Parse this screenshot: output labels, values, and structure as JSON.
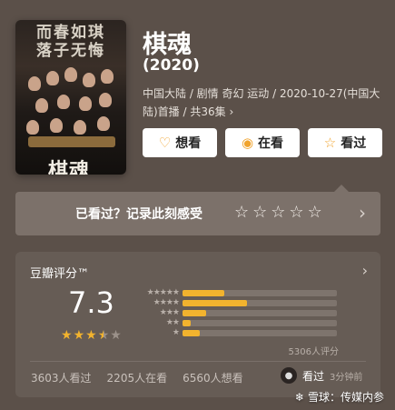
{
  "poster": {
    "tagline_line1": "而春如琪",
    "tagline_line2": "落子无悔",
    "title": "棋魂"
  },
  "movie": {
    "title": "棋魂",
    "year": "(2020)",
    "meta": "中国大陆 / 剧情 奇幻 运动 / 2020-10-27(中国大陆)首播 / 共36集 ›"
  },
  "actions": {
    "want_label": "想看",
    "watching_label": "在看",
    "watched_label": "看过",
    "want_icon": "add-heart-icon",
    "watching_icon": "target-icon",
    "watched_icon": "star-icon"
  },
  "record": {
    "label": "已看过？记录此刻感受",
    "stars": [
      "☆",
      "☆",
      "☆",
      "☆",
      "☆"
    ]
  },
  "rating": {
    "header": "豆瓣评分™",
    "score": "7.3",
    "stars": [
      "★",
      "★",
      "★",
      "★",
      "★"
    ],
    "star_fill": [
      1,
      1,
      1,
      0.5,
      0
    ],
    "star_labels": [
      "★★★★★",
      "★★★★",
      "★★★",
      "★★",
      "★"
    ],
    "distribution": [
      0.27,
      0.42,
      0.15,
      0.05,
      0.11
    ],
    "count_text": "5306人评分",
    "stats": [
      "3603人看过",
      "2205人在看",
      "6560人想看"
    ],
    "friend_label": "看过",
    "friend_time": "3分钟前"
  },
  "watermark": "雪球：传媒内参",
  "colors": {
    "accent": "#f2b32e",
    "background": "#5b5049"
  }
}
